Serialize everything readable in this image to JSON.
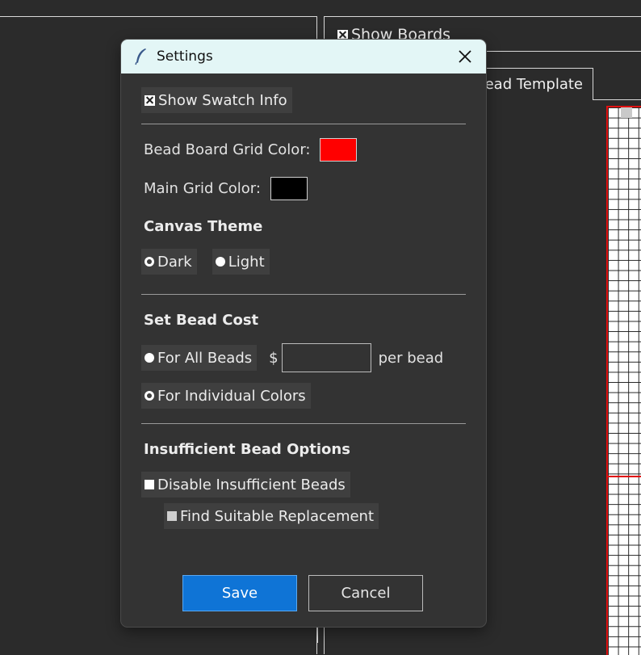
{
  "background": {
    "show_boards_label": "Show Boards",
    "tab_label": "ead Template"
  },
  "dialog": {
    "title": "Settings",
    "close_icon": "close-icon",
    "show_swatch_info_label": "Show Swatch Info",
    "bead_board_grid_color_label": "Bead Board Grid Color:",
    "bead_board_grid_color": "#ff0000",
    "main_grid_color_label": "Main Grid Color:",
    "main_grid_color": "#000000",
    "canvas_theme_heading": "Canvas Theme",
    "theme_dark_label": "Dark",
    "theme_light_label": "Light",
    "set_bead_cost_heading": "Set Bead Cost",
    "for_all_beads_label": "For All Beads",
    "currency_symbol": "$",
    "cost_value": "",
    "per_bead_label": "per bead",
    "for_individual_colors_label": "For Individual Colors",
    "insufficient_heading": "Insufficient Bead Options",
    "disable_insufficient_label": "Disable Insufficient Beads",
    "find_replacement_label": "Find Suitable Replacement",
    "save_label": "Save",
    "cancel_label": "Cancel"
  },
  "colors": {
    "accent": "#0f74d6",
    "titlebar": "#e3f6f6",
    "dialog_bg": "#333333",
    "grid_red": "#e01010"
  }
}
